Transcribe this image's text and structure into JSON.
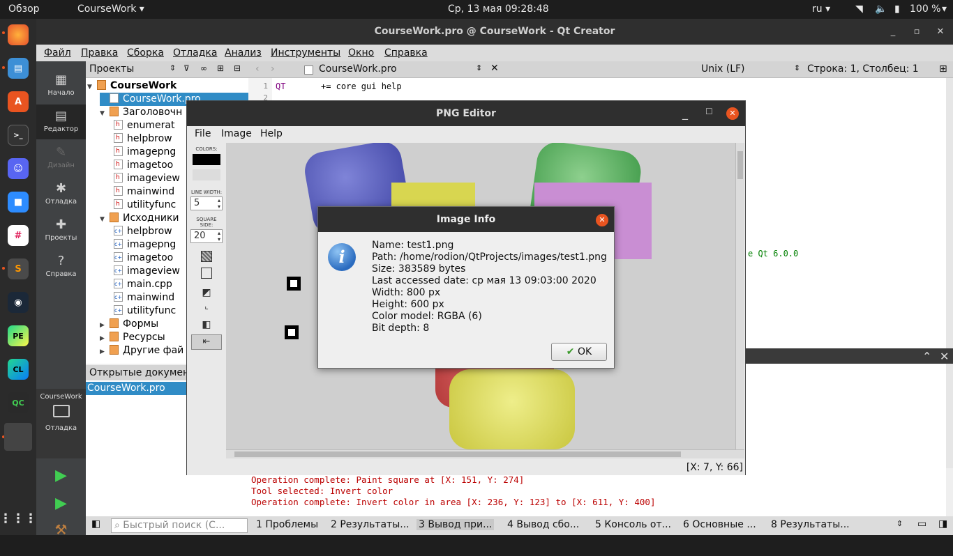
{
  "topbar": {
    "activities": "Обзор",
    "app_menu": "CourseWork",
    "clock": "Ср, 13 мая  09:28:48",
    "lang": "ru",
    "battery": "100 %"
  },
  "dock": {
    "apps": [
      "firefox-icon",
      "files-icon",
      "software-icon",
      "terminal-icon",
      "discord-icon",
      "zoom-icon",
      "slack-icon",
      "sublime-icon",
      "steam-icon",
      "pycharm-icon",
      "clion-icon",
      "qtcreator-icon",
      "blank-app-icon",
      "apps-grid-icon"
    ]
  },
  "qtc": {
    "title": "CourseWork.pro @ CourseWork - Qt Creator",
    "menu": [
      "Файл",
      "Правка",
      "Сборка",
      "Отладка",
      "Анализ",
      "Инструменты",
      "Окно",
      "Справка"
    ],
    "modes": [
      {
        "label": "Начало"
      },
      {
        "label": "Редактор"
      },
      {
        "label": "Дизайн"
      },
      {
        "label": "Отладка"
      },
      {
        "label": "Проекты"
      },
      {
        "label": "Справка"
      }
    ],
    "kit": {
      "project": "CourseWork",
      "mode": "Отладка"
    },
    "projects_header": "Проекты",
    "tree": [
      {
        "label": "CourseWork",
        "level": 0,
        "icon": "folder"
      },
      {
        "label": "CourseWork.pro",
        "level": 1,
        "icon": "pro"
      },
      {
        "label": "Заголовочн",
        "level": 1,
        "icon": "folder"
      },
      {
        "label": "enumerat",
        "level": 2,
        "icon": "h"
      },
      {
        "label": "helpbrow",
        "level": 2,
        "icon": "h"
      },
      {
        "label": "imagepng",
        "level": 2,
        "icon": "h"
      },
      {
        "label": "imagetoo",
        "level": 2,
        "icon": "h"
      },
      {
        "label": "imageview",
        "level": 2,
        "icon": "h"
      },
      {
        "label": "mainwind",
        "level": 2,
        "icon": "h"
      },
      {
        "label": "utilityfunc",
        "level": 2,
        "icon": "h"
      },
      {
        "label": "Исходники",
        "level": 1,
        "icon": "folder"
      },
      {
        "label": "helpbrow",
        "level": 2,
        "icon": "c"
      },
      {
        "label": "imagepng",
        "level": 2,
        "icon": "c"
      },
      {
        "label": "imagetoo",
        "level": 2,
        "icon": "c"
      },
      {
        "label": "imageview",
        "level": 2,
        "icon": "c"
      },
      {
        "label": "main.cpp",
        "level": 2,
        "icon": "c"
      },
      {
        "label": "mainwind",
        "level": 2,
        "icon": "c"
      },
      {
        "label": "utilityfunc",
        "level": 2,
        "icon": "c"
      },
      {
        "label": "Формы",
        "level": 1,
        "icon": "folder"
      },
      {
        "label": "Ресурсы",
        "level": 1,
        "icon": "folder"
      },
      {
        "label": "Другие фай",
        "level": 1,
        "icon": "folder"
      }
    ],
    "open_docs_header": "Открытые документ",
    "open_docs": [
      "CourseWork.pro"
    ],
    "editor": {
      "file": "CourseWork.pro",
      "line_ending": "Unix (LF)",
      "position": "Строка: 1, Столбец: 1",
      "line1_num": "1",
      "line1_key": "QT",
      "line1_rest": "+= core gui help",
      "line2_num": "2",
      "fragment": "e Qt 6.0.0"
    },
    "output": [
      "Operation complete: Paint square at [X: 151, Y: 274]",
      "Tool selected: Invert color",
      "Operation complete: Invert color in area [X: 236, Y: 123] to [X: 611, Y: 400]"
    ],
    "status": {
      "search": "Быстрый поиск (C...",
      "tabs": [
        "1 Проблемы",
        "2 Результаты...",
        "3 Вывод при...",
        "4 Вывод сбо...",
        "5 Консоль от...",
        "6 Основные ...",
        "8 Результаты..."
      ]
    }
  },
  "png_editor": {
    "title": "PNG Editor",
    "menu": [
      "File",
      "Image",
      "Help"
    ],
    "toolbox": {
      "colors": "COLORS:",
      "line_width_label": "LINE WIDTH:",
      "line_width": "5",
      "square_side_label": "SQUARE SIDE:",
      "square_side": "20"
    },
    "status": "[X: 7, Y: 66]"
  },
  "dialog": {
    "title": "Image Info",
    "lines": [
      "Name: test1.png",
      "Path: /home/rodion/QtProjects/images/test1.png",
      "Size: 383589 bytes",
      "Last accessed date: ср мая 13 09:03:00 2020",
      "Width: 800 px",
      "Height: 600 px",
      "Color model: RGBA (6)",
      "Bit depth: 8"
    ],
    "ok": "OK"
  }
}
